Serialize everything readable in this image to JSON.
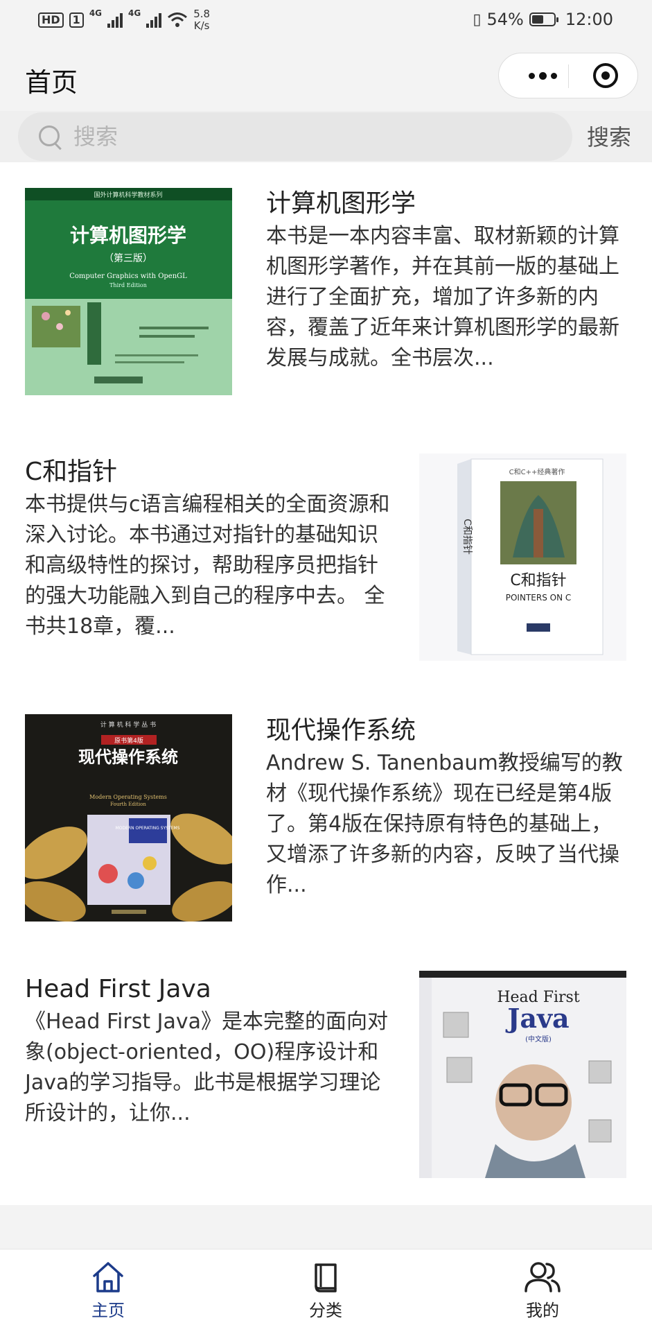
{
  "status_bar": {
    "hd_label": "HD",
    "sim_label": "1",
    "net_1": "4G",
    "net_2": "4G",
    "speed_value": "5.8",
    "speed_unit": "K/s",
    "battery_percent": "54%",
    "battery_level": 0.54,
    "time": "12:00"
  },
  "navbar": {
    "title": "首页"
  },
  "search": {
    "placeholder": "搜索",
    "button_label": "搜索"
  },
  "books": [
    {
      "title": "计算机图形学",
      "description": "本书是一本内容丰富、取材新颖的计算机图形学著作，并在其前一版的基础上进行了全面扩充，增加了许多新的内容，覆盖了近年来计算机图形学的最新发展与成就。全书层次...",
      "cover_title": "计算机图形学",
      "cover_edition": "（第三版）",
      "cover_subtitle": "Computer Graphics with OpenGL",
      "cover_edition_en": "Third Edition",
      "cover_series": "国外计算机科学教材系列"
    },
    {
      "title": "C和指针",
      "description": "本书提供与c语言编程相关的全面资源和深入讨论。本书通过对指针的基础知识和高级特性的探讨，帮助程序员把指针的强大功能融入到自己的程序中去。 全书共18章，覆...",
      "cover_title": "C和指针",
      "cover_subtitle": "POINTERS ON C",
      "cover_series": "C和C++经典著作",
      "cover_spine": "C和指针"
    },
    {
      "title": "现代操作系统",
      "description": "Andrew S. Tanenbaum教授编写的教材《现代操作系统》现在已经是第4版了。第4版在保持原有特色的基础上，又增添了许多新的内容，反映了当代操作...",
      "cover_title": "现代操作系统",
      "cover_badge": "原书第4版",
      "cover_subtitle": "Modern Operating Systems",
      "cover_edition_en": "Fourth Edition",
      "cover_series": "计 算 机 科 学 丛 书",
      "cover_inset": "MODERN OPERATING SYSTEMS"
    },
    {
      "title": "Head First Java",
      "description": "《Head First Java》是本完整的面向对象(object-oriented，OO)程序设计和Java的学习指导。此书是根据学习理论所设计的，让你...",
      "cover_title_1": "Head First",
      "cover_title_2": "Java",
      "cover_edition": "(中文版)"
    }
  ],
  "tabbar": {
    "items": [
      {
        "label": "主页",
        "icon": "home-icon",
        "active": true
      },
      {
        "label": "分类",
        "icon": "book-icon",
        "active": false
      },
      {
        "label": "我的",
        "icon": "users-icon",
        "active": false
      }
    ]
  },
  "colors": {
    "accent": "#1c3b8a",
    "background": "#f3f3f3",
    "card": "#ffffff"
  }
}
